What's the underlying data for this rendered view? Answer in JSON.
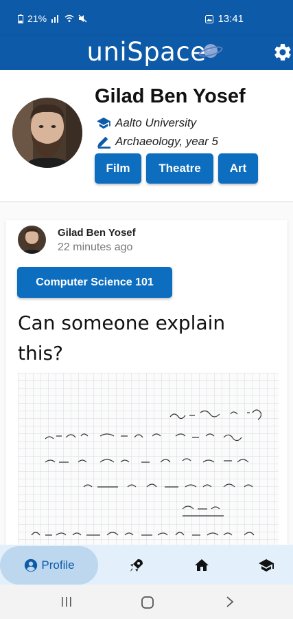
{
  "status_bar": {
    "battery": "21%",
    "time": "13:41"
  },
  "app": {
    "title": "uniSpace"
  },
  "profile": {
    "name": "Gilad Ben Yosef",
    "university": "Aalto University",
    "major": "Archaeology, year 5",
    "interests": [
      "Film",
      "Theatre",
      "Art"
    ]
  },
  "post": {
    "author": "Gilad Ben Yosef",
    "time_ago": "22 minutes ago",
    "course": "Computer Science 101",
    "text": "Can someone explain this?"
  },
  "bottom_nav": {
    "active": "Profile",
    "items": [
      "profile",
      "rocket",
      "home",
      "school"
    ]
  },
  "colors": {
    "primary": "#0d5aa8",
    "chip": "#0d6ebf",
    "nav_bg": "#e3f0fb",
    "nav_active": "#bcd7ee"
  }
}
